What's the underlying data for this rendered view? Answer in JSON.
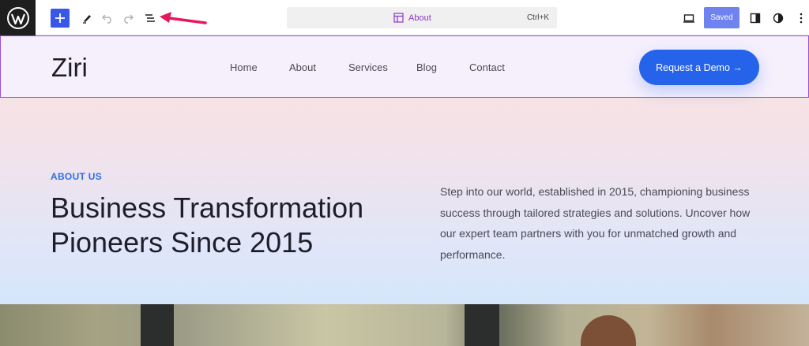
{
  "toolbar": {
    "logo_icon": "wordpress-logo",
    "add_icon": "plus-icon",
    "tools_icon": "pencil-icon",
    "undo_icon": "undo-icon",
    "redo_icon": "redo-icon",
    "listview_icon": "list-view-icon",
    "command": {
      "template_icon": "layout-icon",
      "label": "About",
      "shortcut": "Ctrl+K"
    },
    "preview_icon": "desktop-icon",
    "saved_label": "Saved",
    "settings_icon": "sidebar-icon",
    "styles_icon": "half-circle-icon",
    "options_icon": "kebab-menu-icon",
    "annotation": {
      "type": "arrow",
      "color": "#e8175d",
      "points_to": "list-view-button"
    }
  },
  "site": {
    "title": "Ziri",
    "nav": [
      "Home",
      "About",
      "Services",
      "Blog",
      "Contact"
    ],
    "cta_label": "Request a Demo →"
  },
  "hero": {
    "eyebrow": "ABOUT US",
    "headline_line1": "Business Transformation",
    "headline_line2": "Pioneers Since 2015",
    "intro": "Step into our world, established in 2015, championing business success through tailored strategies and solutions. Uncover how our expert team partners with you for unmatched growth and performance."
  },
  "colors": {
    "accent": "#3858e9",
    "cta": "#2563eb",
    "selection": "#9b4fd6",
    "eyebrow": "#2f6fe6"
  }
}
